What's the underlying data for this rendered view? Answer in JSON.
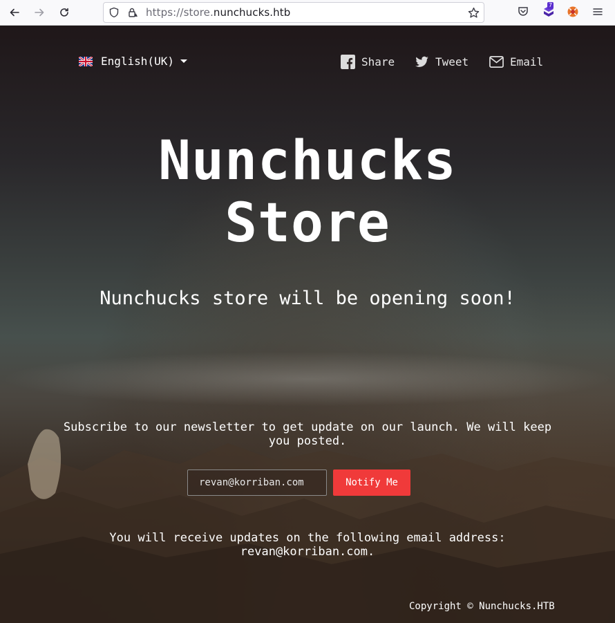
{
  "browser": {
    "url_prefix": "https://store.",
    "url_domain": "nunchucks.htb",
    "extension_badge": "7"
  },
  "header": {
    "language": "English(UK)",
    "share_label": "Share",
    "tweet_label": "Tweet",
    "email_label": "Email"
  },
  "hero": {
    "title_line1": "Nunchucks",
    "title_line2": "Store",
    "subtitle": "Nunchucks store will be opening soon!"
  },
  "newsletter": {
    "text": "Subscribe to our newsletter to get update on our launch. We will keep you posted.",
    "email_value": "revan@korriban.com",
    "button_label": "Notify Me",
    "confirm_line1": "You will receive updates on the following email address:",
    "confirm_line2": "revan@korriban.com."
  },
  "footer": {
    "copyright": "Copyright © Nunchucks.HTB"
  },
  "colors": {
    "accent": "#f03a3a",
    "text": "#ffffff"
  }
}
